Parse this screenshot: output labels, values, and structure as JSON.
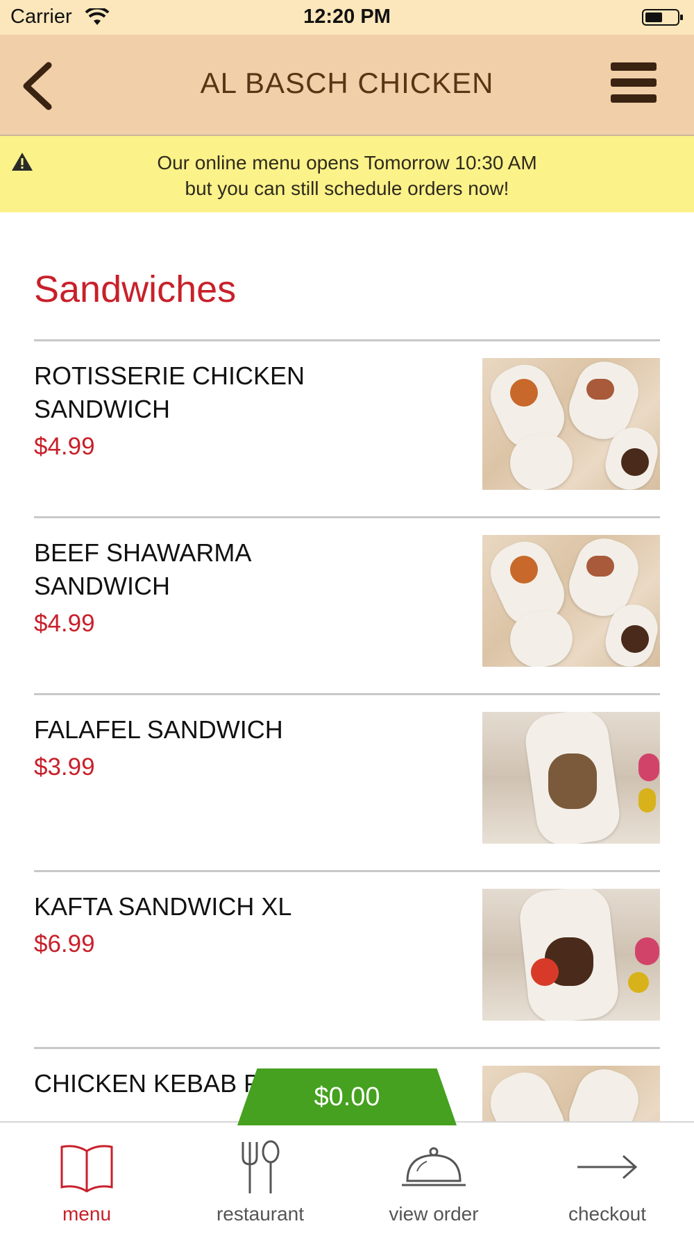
{
  "status_bar": {
    "carrier": "Carrier",
    "time": "12:20 PM"
  },
  "header": {
    "title": "AL BASCH CHICKEN"
  },
  "notice": {
    "line1": "Our online menu opens Tomorrow 10:30 AM",
    "line2": "but you can still schedule orders now!"
  },
  "section": {
    "title": "Sandwiches"
  },
  "items": [
    {
      "name": "ROTISSERIE CHICKEN SANDWICH",
      "price": "$4.99"
    },
    {
      "name": "BEEF SHAWARMA SANDWICH",
      "price": "$4.99"
    },
    {
      "name": "FALAFEL SANDWICH",
      "price": "$3.99"
    },
    {
      "name": "KAFTA SANDWICH XL",
      "price": "$6.99"
    },
    {
      "name": "CHICKEN KEBAB PANINI",
      "price": ""
    }
  ],
  "cart": {
    "total": "$0.00"
  },
  "tabs": [
    {
      "label": "menu",
      "icon": "book-icon",
      "active": true
    },
    {
      "label": "restaurant",
      "icon": "fork-spoon-icon",
      "active": false
    },
    {
      "label": "view order",
      "icon": "cloche-icon",
      "active": false
    },
    {
      "label": "checkout",
      "icon": "arrow-right-icon",
      "active": false
    }
  ],
  "colors": {
    "accent": "#c8202a",
    "header_bg": "#f0cfa9",
    "notice_bg": "#fbf289",
    "cart_green": "#45a11f"
  }
}
